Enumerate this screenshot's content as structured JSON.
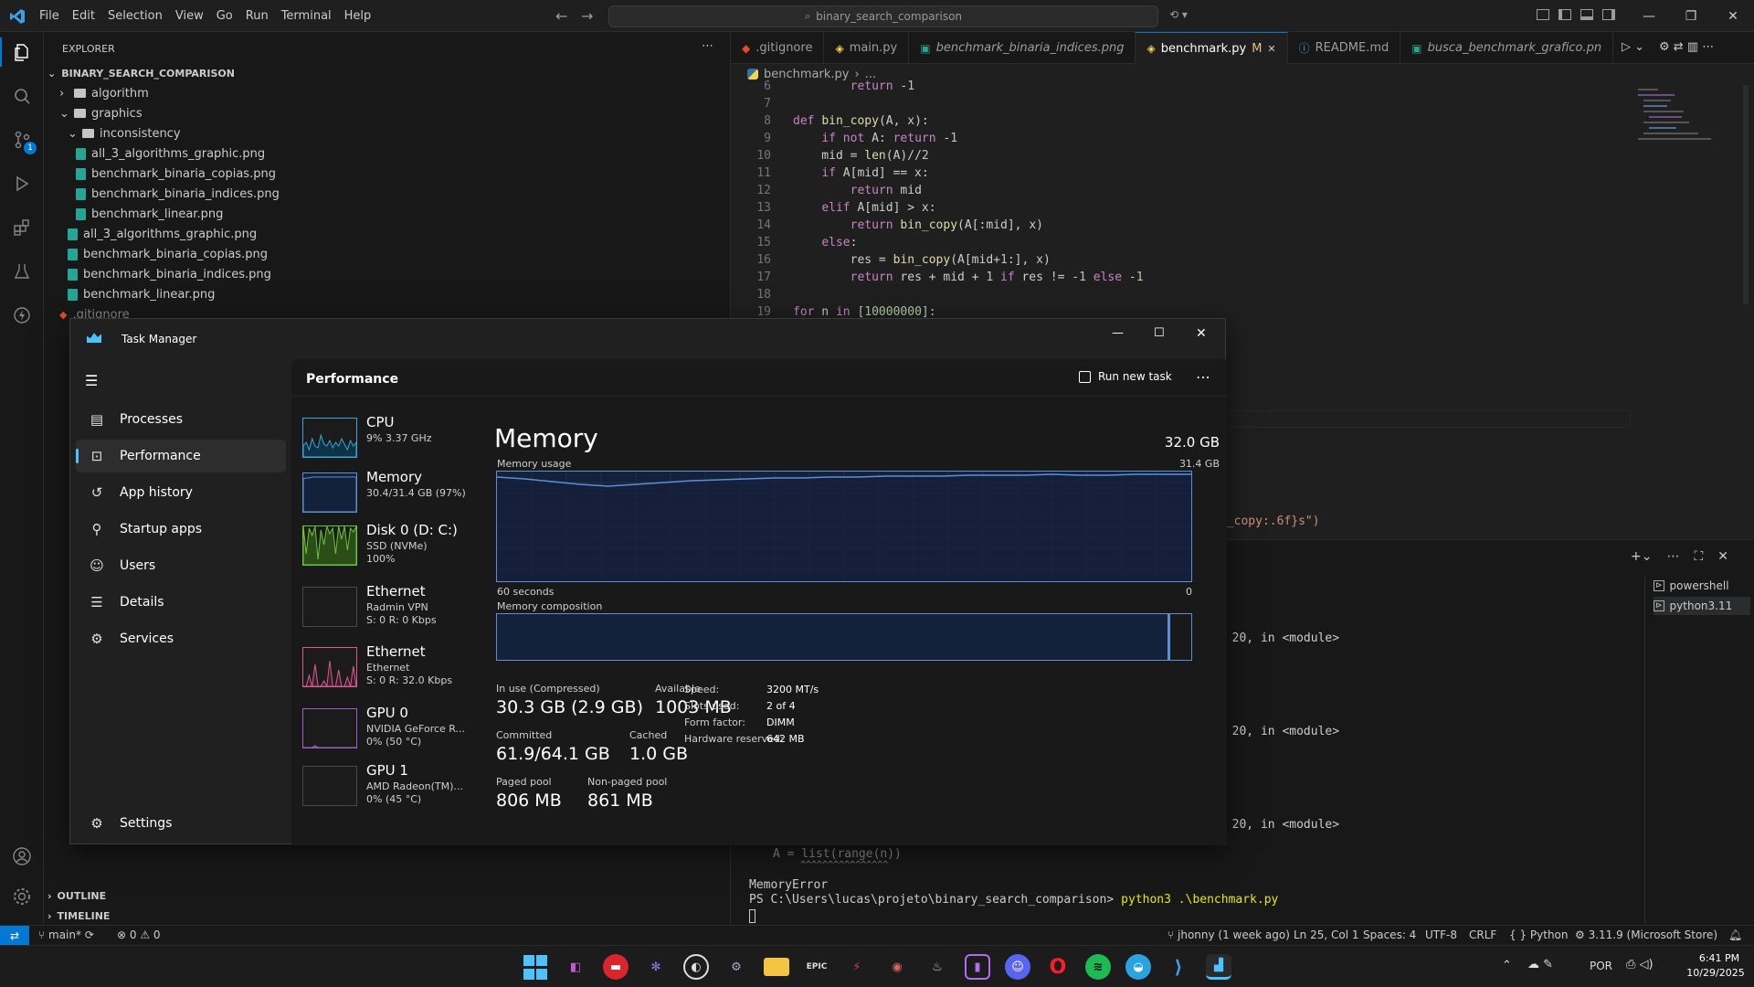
{
  "titlebar": {
    "menus": [
      "File",
      "Edit",
      "Selection",
      "View",
      "Go",
      "Run",
      "Terminal",
      "Help"
    ],
    "search": "binary_search_comparison"
  },
  "explorer": {
    "header": "EXPLORER",
    "root": "BINARY_SEARCH_COMPARISON",
    "items": [
      {
        "label": "algorithm",
        "kind": "folder",
        "depth": 1,
        "open": false
      },
      {
        "label": "graphics",
        "kind": "folder",
        "depth": 1,
        "open": true
      },
      {
        "label": "inconsistency",
        "kind": "folder",
        "depth": 2,
        "open": true
      },
      {
        "label": "all_3_algorithms_graphic.png",
        "kind": "png",
        "depth": 3
      },
      {
        "label": "benchmark_binaria_copias.png",
        "kind": "png",
        "depth": 3
      },
      {
        "label": "benchmark_binaria_indices.png",
        "kind": "png",
        "depth": 3
      },
      {
        "label": "benchmark_linear.png",
        "kind": "png",
        "depth": 3
      },
      {
        "label": "all_3_algorithms_graphic.png",
        "kind": "png",
        "depth": 2
      },
      {
        "label": "benchmark_binaria_copias.png",
        "kind": "png",
        "depth": 2
      },
      {
        "label": "benchmark_binaria_indices.png",
        "kind": "png",
        "depth": 2
      },
      {
        "label": "benchmark_linear.png",
        "kind": "png",
        "depth": 2
      },
      {
        "label": ".gitignore",
        "kind": "git",
        "depth": 1
      }
    ],
    "outline": "OUTLINE",
    "timeline": "TIMELINE"
  },
  "tabs": [
    {
      "label": ".gitignore",
      "icon": "git-icon",
      "active": false
    },
    {
      "label": "main.py",
      "icon": "python-icon",
      "active": false
    },
    {
      "label": "benchmark_binaria_indices.png",
      "icon": "image-icon",
      "active": false
    },
    {
      "label": "benchmark.py",
      "icon": "python-icon",
      "active": true,
      "badge": "M"
    },
    {
      "label": "README.md",
      "icon": "info-icon",
      "active": false
    },
    {
      "label": "busca_benchmark_grafico.pn",
      "icon": "image-icon",
      "active": false
    }
  ],
  "breadcrumb": {
    "file": "benchmark.py",
    "rest": "..."
  },
  "code": [
    {
      "n": "6",
      "text": "        return -1"
    },
    {
      "n": "7",
      "text": ""
    },
    {
      "n": "8",
      "text": "def bin_copy(A, x):"
    },
    {
      "n": "9",
      "text": "    if not A: return -1"
    },
    {
      "n": "10",
      "text": "    mid = len(A)//2"
    },
    {
      "n": "11",
      "text": "    if A[mid] == x:"
    },
    {
      "n": "12",
      "text": "        return mid"
    },
    {
      "n": "13",
      "text": "    elif A[mid] > x:"
    },
    {
      "n": "14",
      "text": "        return bin_copy(A[:mid], x)"
    },
    {
      "n": "15",
      "text": "    else:"
    },
    {
      "n": "16",
      "text": "        res = bin_copy(A[mid+1:], x)"
    },
    {
      "n": "17",
      "text": "        return res + mid + 1 if res != -1 else -1"
    },
    {
      "n": "18",
      "text": ""
    },
    {
      "n": "19",
      "text": "for n in [10000000]:"
    }
  ],
  "code_fragment": "n_copy:.6f}s\")",
  "terminal": {
    "sessions": [
      "powershell",
      "python3.11"
    ],
    "module_lines": [
      "e 20, in <module>",
      "e 20, in <module>",
      "e 20, in <module>"
    ],
    "code_echo": "A = list(range(n))",
    "carets": "^^^^^^^^^^^^^^^^",
    "error": "MemoryError",
    "prompt": "PS C:\\Users\\lucas\\projeto\\binary_search_comparison>",
    "command": "python3 .\\benchmark.py"
  },
  "statusbar": {
    "branch": "main*",
    "problems": "⊗ 0 ⚠ 0",
    "blame": "jhonny (1 week ago)",
    "position": "Ln 25, Col 1",
    "spaces": "Spaces: 4",
    "encoding": "UTF-8",
    "eol": "CRLF",
    "language": "Python",
    "interpreter": "3.11.9 (Microsoft Store)"
  },
  "taskmgr": {
    "title": "Task Manager",
    "section": "Performance",
    "run_new_task": "Run new task",
    "nav": [
      {
        "label": "Processes",
        "icon": "processes-icon"
      },
      {
        "label": "Performance",
        "icon": "performance-icon"
      },
      {
        "label": "App history",
        "icon": "app-history-icon"
      },
      {
        "label": "Startup apps",
        "icon": "startup-apps-icon"
      },
      {
        "label": "Users",
        "icon": "users-icon"
      },
      {
        "label": "Details",
        "icon": "details-icon"
      },
      {
        "label": "Services",
        "icon": "services-icon"
      }
    ],
    "settings": "Settings",
    "resources": [
      {
        "name": "CPU",
        "sub1": "9% 3.37 GHz",
        "sub2": "",
        "sub3": ""
      },
      {
        "name": "Memory",
        "sub1": "30.4/31.4 GB (97%)",
        "sub2": "",
        "sub3": ""
      },
      {
        "name": "Disk 0 (D: C:)",
        "sub1": "SSD (NVMe)",
        "sub2": "100%",
        "sub3": ""
      },
      {
        "name": "Ethernet",
        "sub1": "Radmin VPN",
        "sub2": "S: 0 R: 0 Kbps",
        "sub3": ""
      },
      {
        "name": "Ethernet",
        "sub1": "Ethernet",
        "sub2": "S: 0 R: 32.0 Kbps",
        "sub3": ""
      },
      {
        "name": "GPU 0",
        "sub1": "NVIDIA GeForce R...",
        "sub2": "0% (50 °C)",
        "sub3": ""
      },
      {
        "name": "GPU 1",
        "sub1": "AMD Radeon(TM)...",
        "sub2": "0% (45 °C)",
        "sub3": ""
      }
    ],
    "memory": {
      "heading": "Memory",
      "total": "32.0 GB",
      "usage_label": "Memory usage",
      "usage_max": "31.4 GB",
      "time_left": "60 seconds",
      "time_right": "0",
      "composition_label": "Memory composition",
      "usage_fraction": 0.97,
      "stats": {
        "in_use_label": "In use (Compressed)",
        "in_use": "30.3 GB (2.9 GB)",
        "available_label": "Available",
        "available": "1003 MB",
        "committed_label": "Committed",
        "committed": "61.9/64.1 GB",
        "cached_label": "Cached",
        "cached": "1.0 GB",
        "paged_label": "Paged pool",
        "paged": "806 MB",
        "nonpaged_label": "Non-paged pool",
        "nonpaged": "861 MB"
      },
      "specs": [
        {
          "label": "Speed:",
          "value": "3200 MT/s"
        },
        {
          "label": "Slots used:",
          "value": "2 of 4"
        },
        {
          "label": "Form factor:",
          "value": "DIMM"
        },
        {
          "label": "Hardware reserved:",
          "value": "642 MB"
        }
      ]
    }
  },
  "taskbar": {
    "language": "POR",
    "time": "6:41 PM",
    "date": "10/29/2025"
  },
  "colors": {
    "accent": "#0078d4",
    "memory_line": "#5b8fd6",
    "memory_fill": "#15203a",
    "disk_green": "#6bc437",
    "cpu_cyan": "#34a7d6",
    "eth_pink": "#d75c8f",
    "gpu_purple": "#a05fc7"
  }
}
